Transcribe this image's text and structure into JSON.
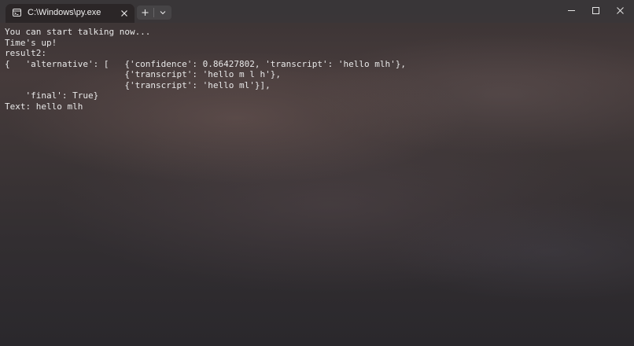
{
  "window": {
    "tab_title": "C:\\Windows\\py.exe",
    "tab_icon": "terminal-icon",
    "tab_close_icon": "close-icon",
    "new_tab_icon": "plus-icon",
    "tab_dropdown_icon": "chevron-down-icon",
    "caption_buttons": [
      "minimize-icon",
      "maximize-icon",
      "close-icon"
    ]
  },
  "terminal": {
    "lines": [
      "You can start talking now...",
      "Time's up!",
      "result2:",
      "{   'alternative': [   {'confidence': 0.86427802, 'transcript': 'hello mlh'},",
      "                       {'transcript': 'hello m l h'},",
      "                       {'transcript': 'hello ml'}],",
      "    'final': True}",
      "Text: hello mlh"
    ]
  },
  "colors": {
    "titlebar": "#3a3638",
    "active_tab": "#2b2627",
    "text": "#e8e8e8"
  }
}
